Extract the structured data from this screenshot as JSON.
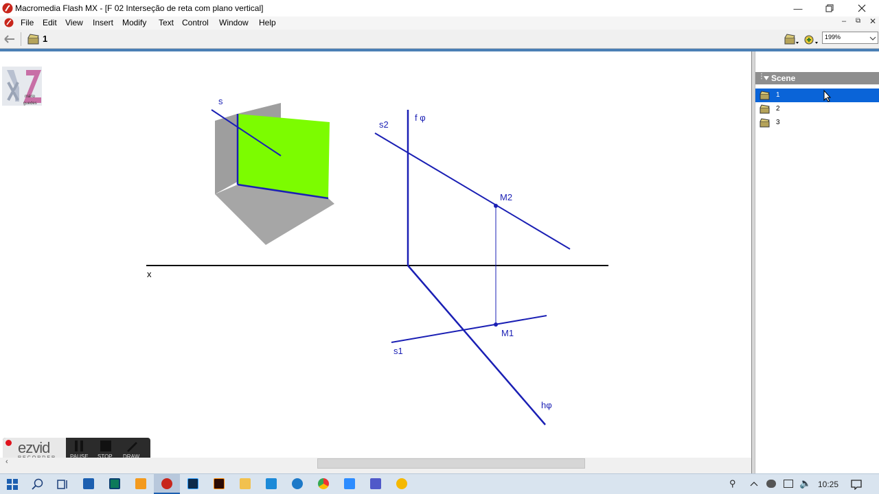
{
  "window": {
    "title": "Macromedia Flash MX - [F 02 Interseção de reta com plano vertical]"
  },
  "menubar": {
    "items": [
      "File",
      "Edit",
      "View",
      "Insert",
      "Modify",
      "Text",
      "Control",
      "Window",
      "Help"
    ]
  },
  "editbar": {
    "scene_label": "1",
    "zoom": "199%"
  },
  "drawing": {
    "label_s": "s",
    "label_s2": "s2",
    "label_f_phi": "f φ",
    "label_M2": "M2",
    "label_x": "x",
    "label_M1": "M1",
    "label_s1": "s1",
    "label_h_phi": "hφ"
  },
  "logo": {
    "line1": "mário",
    "line2": "guedes"
  },
  "scene_panel": {
    "title": "Scene",
    "scenes": [
      "1",
      "2",
      "3"
    ]
  },
  "ezvid": {
    "brand": "ezvid",
    "sub": "RECORDER",
    "pause": "PAUSE",
    "stop": "STOP",
    "draw": "DRAW"
  },
  "taskbar": {
    "time": "10:25"
  },
  "colors": {
    "line_blue": "#1a1fb4",
    "plane_green": "#7cfc00",
    "panel_selected": "#0a64d8"
  }
}
